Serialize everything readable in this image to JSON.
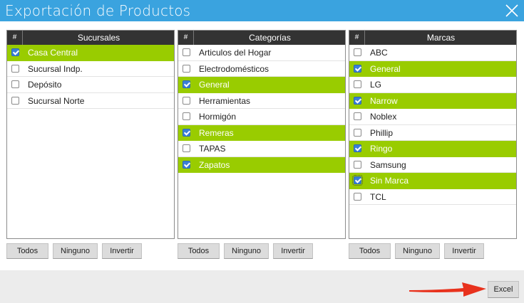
{
  "window": {
    "title": "Exportación de Productos",
    "close_icon": "close-icon"
  },
  "colors": {
    "titlebar": "#3aa3df",
    "selected_row": "#99cc00",
    "header": "#333333",
    "arrow": "#e8321d"
  },
  "hash_label": "#",
  "sucursales": {
    "header": "Sucursales",
    "items": [
      {
        "label": "Casa Central",
        "checked": true
      },
      {
        "label": "Sucursal Indp.",
        "checked": false
      },
      {
        "label": "Depósito",
        "checked": false
      },
      {
        "label": "Sucursal Norte",
        "checked": false
      }
    ]
  },
  "categorias": {
    "header": "Categorías",
    "items": [
      {
        "label": "Articulos del Hogar",
        "checked": false
      },
      {
        "label": "Electrodomésticos",
        "checked": false
      },
      {
        "label": "General",
        "checked": true
      },
      {
        "label": "Herramientas",
        "checked": false
      },
      {
        "label": "Hormigón",
        "checked": false
      },
      {
        "label": "Remeras",
        "checked": true
      },
      {
        "label": "TAPAS",
        "checked": false
      },
      {
        "label": "Zapatos",
        "checked": true
      }
    ]
  },
  "marcas": {
    "header": "Marcas",
    "items": [
      {
        "label": "ABC",
        "checked": false
      },
      {
        "label": "General",
        "checked": true
      },
      {
        "label": "LG",
        "checked": false
      },
      {
        "label": "Narrow",
        "checked": true
      },
      {
        "label": "Noblex",
        "checked": false
      },
      {
        "label": "Phillip",
        "checked": false
      },
      {
        "label": "Ringo",
        "checked": true
      },
      {
        "label": "Samsung",
        "checked": false
      },
      {
        "label": "Sin Marca",
        "checked": true
      },
      {
        "label": "TCL",
        "checked": false
      }
    ]
  },
  "buttons": {
    "todos": "Todos",
    "ninguno": "Ninguno",
    "invertir": "Invertir"
  },
  "footer": {
    "excel": "Excel"
  }
}
